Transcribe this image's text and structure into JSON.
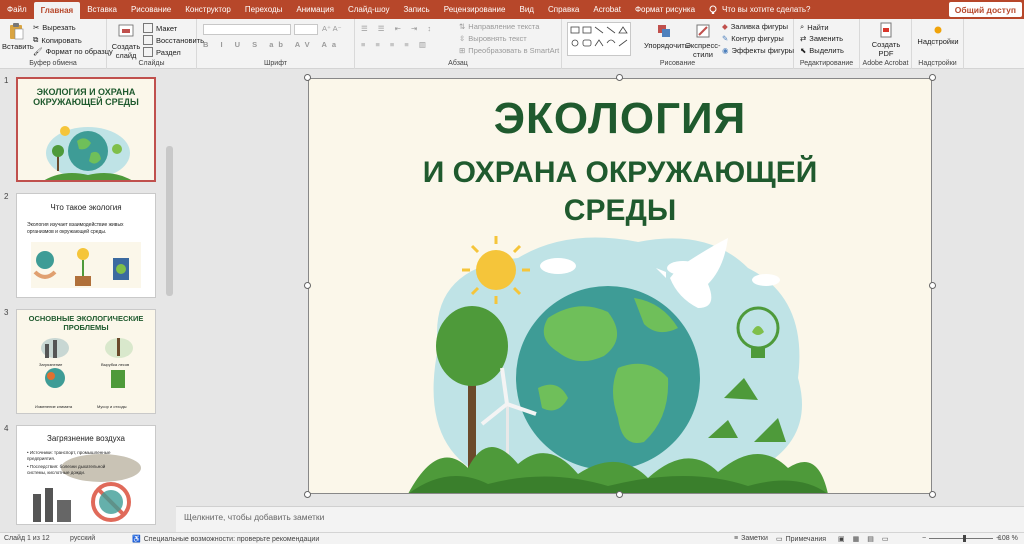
{
  "tabs": [
    {
      "label": "Файл"
    },
    {
      "label": "Главная"
    },
    {
      "label": "Вставка"
    },
    {
      "label": "Рисование"
    },
    {
      "label": "Конструктор"
    },
    {
      "label": "Переходы"
    },
    {
      "label": "Анимация"
    },
    {
      "label": "Слайд-шоу"
    },
    {
      "label": "Запись"
    },
    {
      "label": "Рецензирование"
    },
    {
      "label": "Вид"
    },
    {
      "label": "Справка"
    },
    {
      "label": "Acrobat"
    },
    {
      "label": "Формат рисунка"
    }
  ],
  "tell_me": "Что вы хотите сделать?",
  "share": "Общий доступ",
  "ribbon": {
    "clipboard": {
      "paste": "Вставить",
      "cut": "Вырезать",
      "copy": "Копировать",
      "format_painter": "Формат по образцу",
      "label": "Буфер обмена"
    },
    "slides": {
      "new_slide": "Создать слайд",
      "layout": "Макет",
      "reset": "Восстановить",
      "section": "Раздел",
      "label": "Слайды"
    },
    "font": {
      "label": "Шрифт"
    },
    "paragraph": {
      "text_direction": "Направление текста",
      "align_text": "Выровнять текст",
      "smartart": "Преобразовать в SmartArt",
      "label": "Абзац"
    },
    "drawing": {
      "arrange": "Упорядочить",
      "quick_styles": "Экспресс-стили",
      "shape_fill": "Заливка фигуры",
      "shape_outline": "Контур фигуры",
      "shape_effects": "Эффекты фигуры",
      "label": "Рисование"
    },
    "editing": {
      "find": "Найти",
      "replace": "Заменить",
      "select": "Выделить",
      "label": "Редактирование"
    },
    "acrobat": {
      "create_pdf": "Создать PDF",
      "label": "Adobe Acrobat"
    },
    "addins": {
      "addins": "Надстройки",
      "label": "Надстройки"
    }
  },
  "thumbnails": [
    {
      "num": "1",
      "title": "ЭКОЛОГИЯ И ОХРАНА ОКРУЖАЮЩЕЙ СРЕДЫ"
    },
    {
      "num": "2",
      "title": "Что такое экология",
      "body": "Экология изучает взаимодействие живых организмов и окружающей среды."
    },
    {
      "num": "3",
      "title": "ОСНОВНЫЕ ЭКОЛОГИЧЕСКИЕ ПРОБЛЕМЫ",
      "items": [
        "Загрязнение",
        "Вырубка лесов",
        "Изменение климата",
        "Мусор и отходы"
      ]
    },
    {
      "num": "4",
      "title": "Загрязнение воздуха",
      "bullets": [
        "Источники: транспорт, промышленные предприятия.",
        "Последствия: болезни дыхательной системы, кислотные дожди."
      ]
    }
  ],
  "slide": {
    "line1": "ЭКОЛОГИЯ",
    "line2": "И ОХРАНА ОКРУЖАЮЩЕЙ",
    "line3": "СРЕДЫ"
  },
  "notes_placeholder": "Щелкните, чтобы добавить заметки",
  "status": {
    "slide_of": "Слайд 1 из 12",
    "language": "русский",
    "accessibility": "Специальные возможности: проверьте рекомендации",
    "notes": "Заметки",
    "comments": "Примечания",
    "zoom": "108 %"
  },
  "colors": {
    "accent": "#b7472a",
    "title_green": "#1f5a2e"
  }
}
